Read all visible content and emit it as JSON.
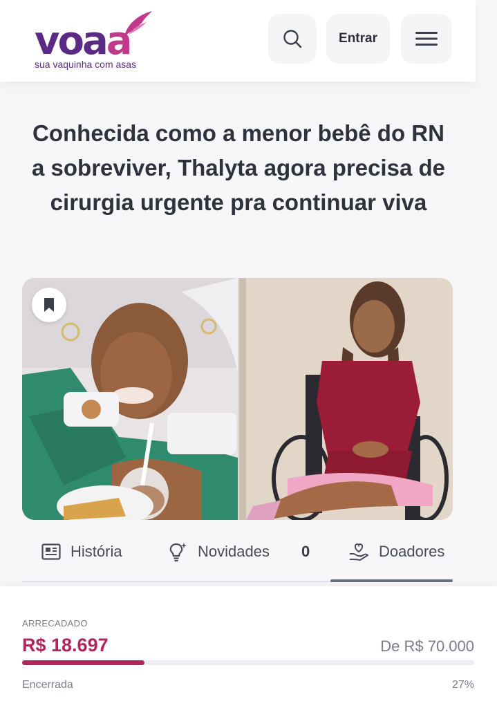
{
  "header": {
    "logo_text": "voaa",
    "tagline": "sua vaquinha com asas",
    "login_label": "Entrar",
    "icons": [
      "search-icon",
      "menu-icon"
    ]
  },
  "campaign": {
    "title": "Conhecida como a menor bebê do RN a sobreviver, Thalyta agora precisa de cirurgia urgente pra continuar viva"
  },
  "tabs": [
    {
      "label": "História",
      "icon": "newspaper-icon"
    },
    {
      "label": "Novidades",
      "icon": "lightbulb-icon",
      "count": "0"
    },
    {
      "label": "Doadores",
      "icon": "heart-hand-icon",
      "active": true
    }
  ],
  "progress": {
    "label": "ARRECADADO",
    "raised": "R$ 18.697",
    "goal": "De R$ 70.000",
    "status": "Encerrada",
    "percent_label": "27%",
    "fraction": 0.27
  },
  "colors": {
    "brand": "#5b2a84",
    "accent": "#b1255a",
    "wing": "#c0398a"
  }
}
